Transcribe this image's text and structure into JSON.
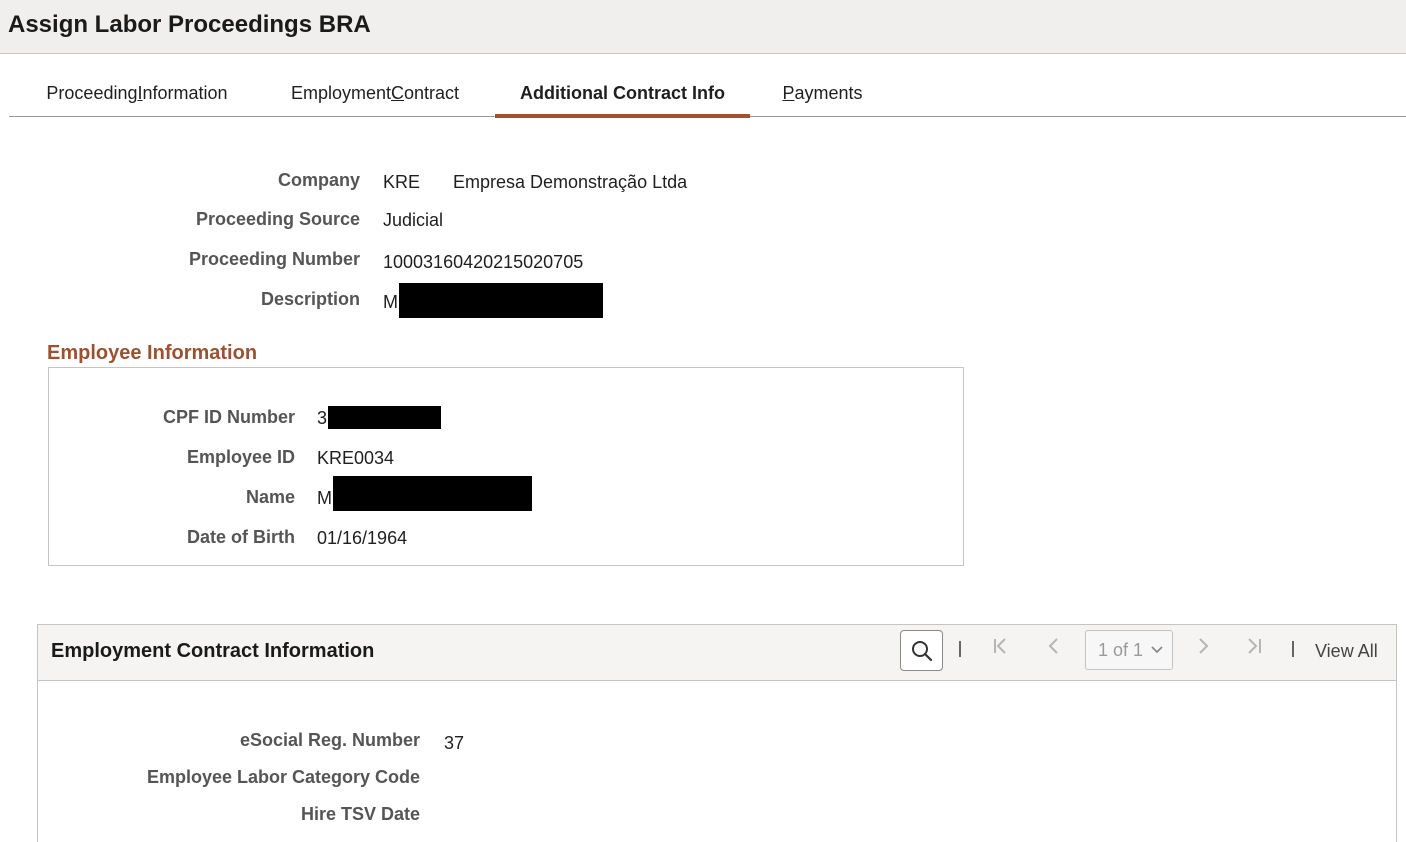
{
  "header": {
    "title": "Assign Labor Proceedings BRA"
  },
  "tabs": [
    {
      "pre": "Proceeding ",
      "key": "I",
      "post": "nformation"
    },
    {
      "pre": "Employment ",
      "key": "C",
      "post": "ontract"
    },
    {
      "pre": "Additional Contract Info",
      "key": "",
      "post": ""
    },
    {
      "pre": "",
      "key": "P",
      "post": "ayments"
    }
  ],
  "proceeding": {
    "company_label": "Company",
    "company_code": "KRE",
    "company_name": "Empresa Demonstração Ltda",
    "source_label": "Proceeding Source",
    "source_value": "Judicial",
    "number_label": "Proceeding Number",
    "number_value": "10003160420215020705",
    "description_label": "Description",
    "description_value": "M"
  },
  "employee": {
    "section_title": "Employee Information",
    "cpf_label": "CPF ID Number",
    "cpf_value": "3",
    "id_label": "Employee ID",
    "id_value": "KRE0034",
    "name_label": "Name",
    "name_value": "M",
    "dob_label": "Date of Birth",
    "dob_value": "01/16/1964"
  },
  "contract": {
    "title": "Employment Contract Information",
    "pager_value": "1 of 1",
    "view_all": "View All",
    "esocial_label": "eSocial Reg. Number",
    "esocial_value": "37",
    "category_label": "Employee Labor Category Code",
    "hire_label": "Hire TSV Date"
  },
  "icons": {
    "search": "search-icon",
    "first": "first-page-icon",
    "prev": "previous-page-icon",
    "next": "next-page-icon",
    "last": "last-page-icon"
  },
  "colors": {
    "accent": "#a0522d",
    "section": "#9a5232"
  }
}
